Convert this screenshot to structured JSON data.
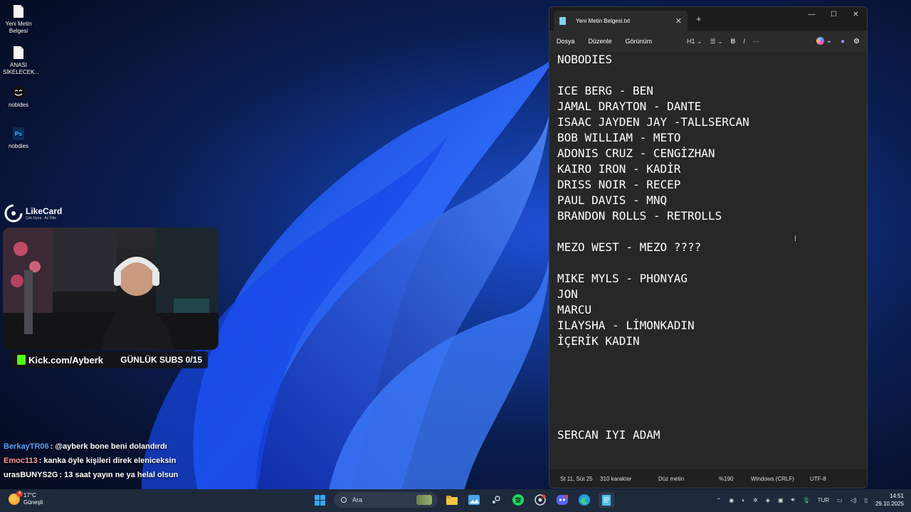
{
  "desktop": {
    "icons": [
      {
        "label": "Yeni Metin Belgesi",
        "icon": "text-file-icon"
      },
      {
        "label": "ANASI SİKELECEK...",
        "icon": "text-file-icon"
      },
      {
        "label": "nobides",
        "icon": "face-icon"
      },
      {
        "label": "nobdies",
        "icon": "photoshop-file-icon"
      }
    ]
  },
  "overlay": {
    "likecard_title": "LikeCard",
    "likecard_subtitle": "Çok Oyna · Az Öde",
    "kick_channel": "Kick.com/Ayberk",
    "daily_subs": "GÜNLÜK SUBS 0/15",
    "chat": [
      {
        "user": "BerkayTR06",
        "color": "#5aa0ff",
        "message": ": @ayberk bone beni dolandırdı"
      },
      {
        "user": "Emoc113",
        "color": "#ff9a9a",
        "message": ": kanka öyle kişileri direk eleniceksin"
      },
      {
        "user": "urasBUNYS2G",
        "color": "#ffffff",
        "message": ": 13 saat yayın ne ya helal olsun"
      }
    ]
  },
  "notepad": {
    "tab_title": "Yeni Metin Belgesi.txt",
    "menu": [
      "Dosya",
      "Düzenle",
      "Görünüm"
    ],
    "toolbar": {
      "heading": "H1",
      "bold": "B",
      "italic": "I",
      "more": "···"
    },
    "lines": [
      "NOBODIES",
      "",
      "ICE BERG - BEN",
      "JAMAL DRAYTON - DANTE",
      "ISAAC JAYDEN JAY -TALLSERCAN",
      "BOB WILLIAM - METO",
      "ADONIS CRUZ - CENGİZHAN",
      "KAIRO IRON - KADİR",
      "DRISS NOIR - RECEP",
      "PAUL DAVIS - MNQ",
      "BRANDON ROLLS - RETROLLS",
      "",
      "MEZO WEST - MEZO ????",
      "",
      "MIKE MYLS - PHONYAG",
      "JON",
      "MARCU",
      "ILAYSHA - LİMONKADIN",
      "İÇERİK KADIN",
      "",
      "",
      "",
      "",
      "",
      "SERCAN IYI ADAM"
    ],
    "status": {
      "position": "St 11, Süt 25",
      "chars": "310 karakter",
      "format": "Düz metin",
      "zoom": "%190",
      "line_ending": "Windows (CRLF)",
      "encoding": "UTF-8"
    }
  },
  "taskbar": {
    "weather_temp": "17°C",
    "weather_desc": "Güneşli",
    "weather_badge": "4",
    "search_placeholder": "Ara",
    "apps": [
      "file-explorer-icon",
      "photos-icon",
      "steam-icon",
      "spotify-icon",
      "chrome-icon",
      "discord-icon",
      "edge-icon",
      "notepad-icon"
    ],
    "language": "TUR",
    "time": "14:51",
    "date": "29.10.2025"
  }
}
